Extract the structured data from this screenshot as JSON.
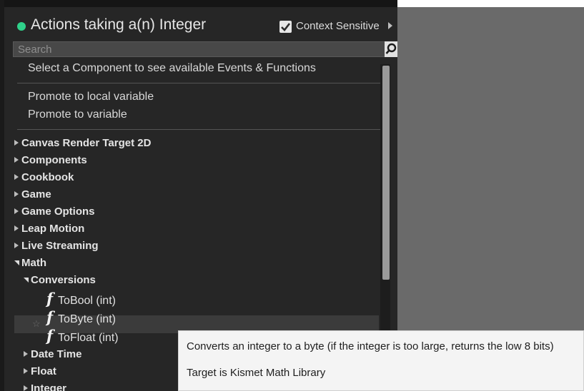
{
  "header": {
    "title": "Actions taking a(n) Integer",
    "context_sensitive_label": "Context Sensitive",
    "context_sensitive_checked": true
  },
  "search": {
    "placeholder": "Search",
    "value": ""
  },
  "messages": {
    "select_component": "Select a Component to see available Events & Functions"
  },
  "promote": {
    "local_variable": "Promote to local variable",
    "variable": "Promote to variable"
  },
  "categories": [
    "Canvas Render Target 2D",
    "Components",
    "Cookbook",
    "Game",
    "Game Options",
    "Leap Motion",
    "Live Streaming",
    "Math"
  ],
  "math": {
    "subcategory": "Conversions",
    "functions": [
      "ToBool (int)",
      "ToByte (int)",
      "ToFloat (int)"
    ],
    "more_subcategories": [
      "Date Time",
      "Float",
      "Integer"
    ]
  },
  "tooltip": {
    "description": "Converts an integer to a byte (if the integer is too large, returns the low 8 bits)",
    "target": "Target is Kismet Math Library"
  },
  "colors": {
    "panel_bg": "#262626",
    "graph_bg": "#6a6a6a",
    "status_dot": "#2fd18a",
    "tooltip_bg": "#f4f4f4"
  }
}
